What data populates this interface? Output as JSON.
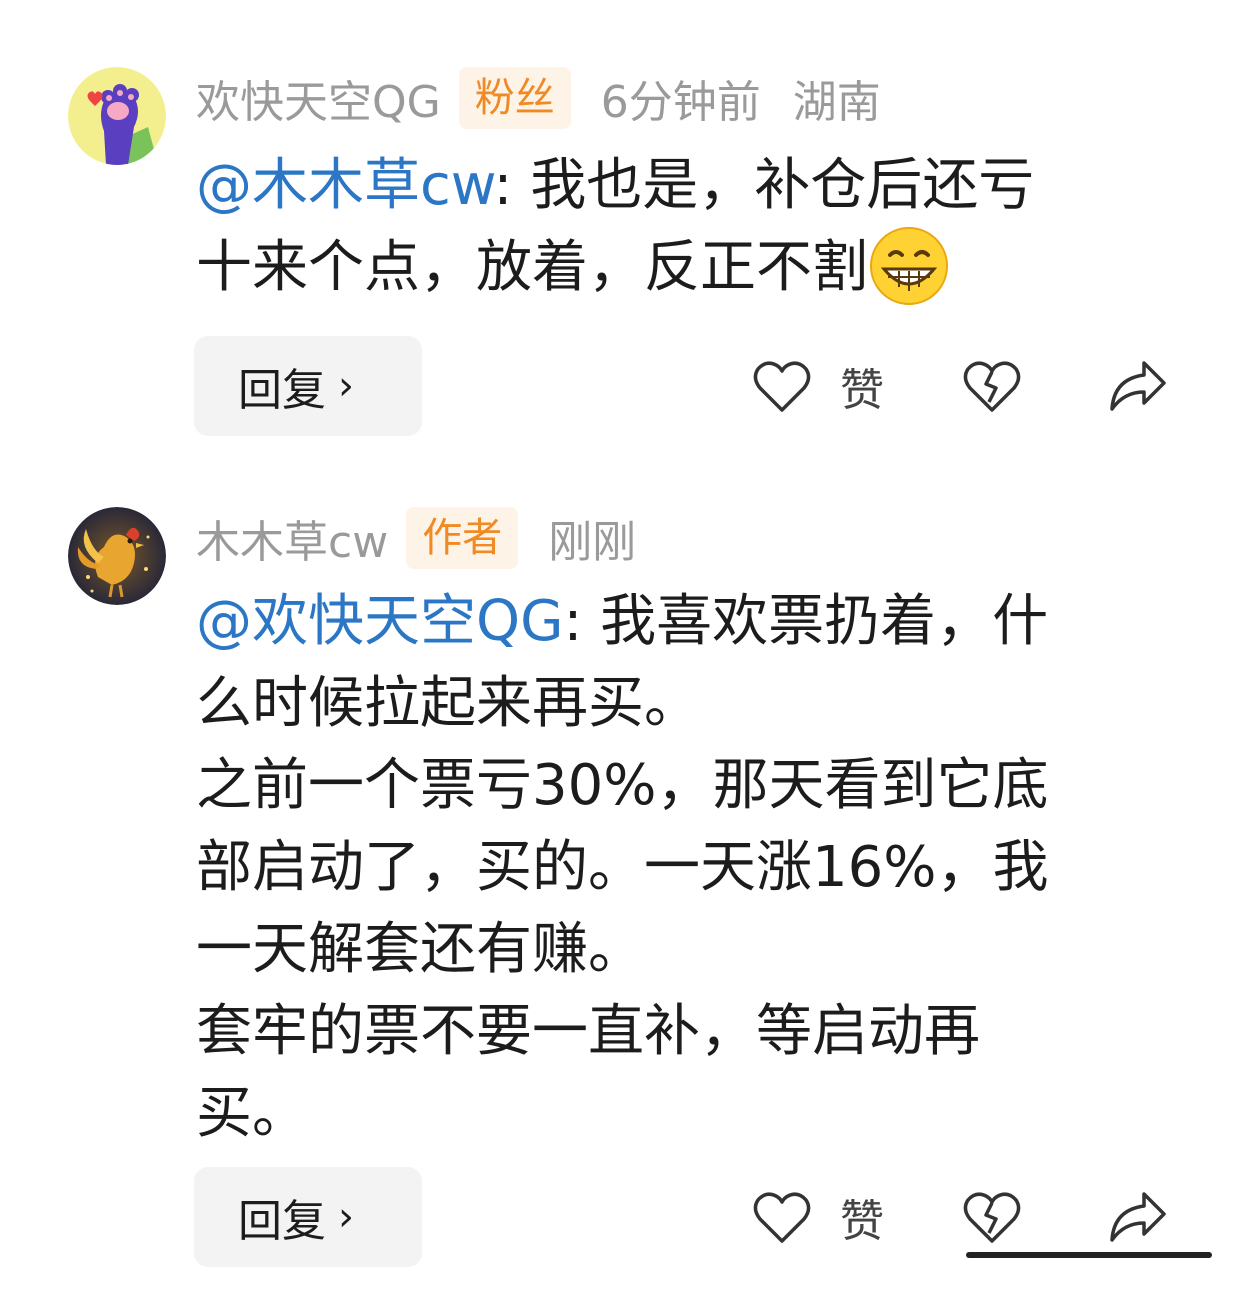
{
  "comments": [
    {
      "username": "欢快天空QG",
      "badge": "粉丝",
      "time": "6分钟前",
      "region": "湖南",
      "mention": "@木木草cw",
      "lines": [
        ": 我也是，补仓后还亏",
        "十来个点，放着，反正不割"
      ],
      "emoji_name": "grinning-face-emoji",
      "reply_label": "回复",
      "like_label": "赞"
    },
    {
      "username": "木木草cw",
      "badge": "作者",
      "time": "刚刚",
      "region": "",
      "mention": "@欢快天空QG",
      "lines": [
        ": 我喜欢票扔着，什",
        "么时候拉起来再买。",
        "之前一个票亏30%，那天看到它底",
        "部启动了，买的。一天涨16%，我",
        "一天解套还有赚。",
        "套牢的票不要一直补，等启动再",
        "买。"
      ],
      "reply_label": "回复",
      "like_label": "赞"
    }
  ],
  "colors": {
    "mention": "#2b77c5",
    "badge_text": "#f08a24",
    "badge_bg": "#fdf3e6",
    "meta_text": "#9a9a9a"
  }
}
